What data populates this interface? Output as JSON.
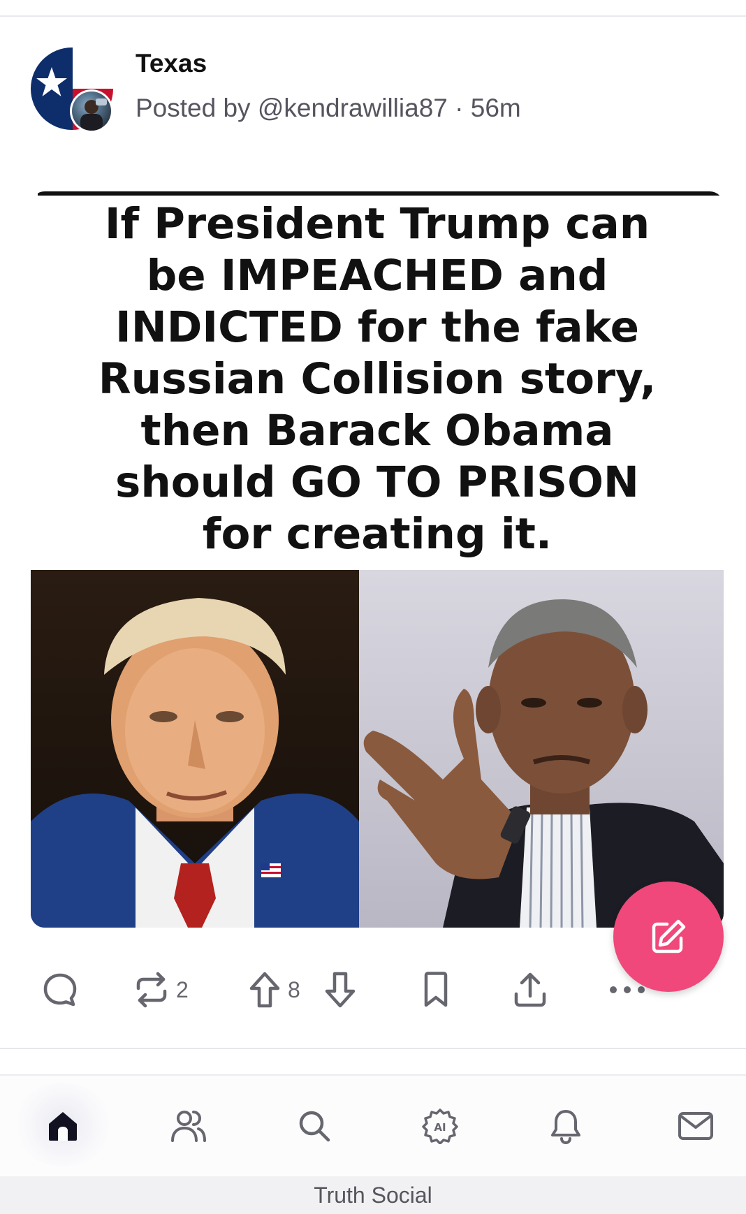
{
  "post": {
    "group_name": "Texas",
    "posted_by": "Posted by @kendrawillia87 · 56m",
    "group_avatar_icon": "texas-flag-icon",
    "user_avatar_icon": "user-photo-avatar"
  },
  "meme": {
    "lines": [
      "If President Trump can",
      "be IMPEACHED and",
      "INDICTED for the fake",
      "Russian Collision story,",
      "then Barack Obama",
      "should GO TO PRISON",
      "for creating it."
    ],
    "left_photo": "trump-portrait-photo",
    "right_photo": "obama-portrait-photo"
  },
  "actions": {
    "reply_icon": "reply-icon",
    "repost_icon": "repost-icon",
    "repost_count": "2",
    "upvote_icon": "upvote-icon",
    "upvote_count": "8",
    "downvote_icon": "downvote-icon",
    "bookmark_icon": "bookmark-icon",
    "share_icon": "share-icon",
    "more_icon": "more-icon"
  },
  "fab": {
    "icon": "compose-icon",
    "color": "#f0487a"
  },
  "nav": {
    "items": [
      "home-icon",
      "groups-icon",
      "search-icon",
      "ai-icon",
      "notifications-icon",
      "messages-icon"
    ],
    "active": "home-icon"
  },
  "footer": {
    "label": "Truth Social"
  },
  "colors": {
    "accent": "#f0487a",
    "icon_gray": "#66666f"
  }
}
